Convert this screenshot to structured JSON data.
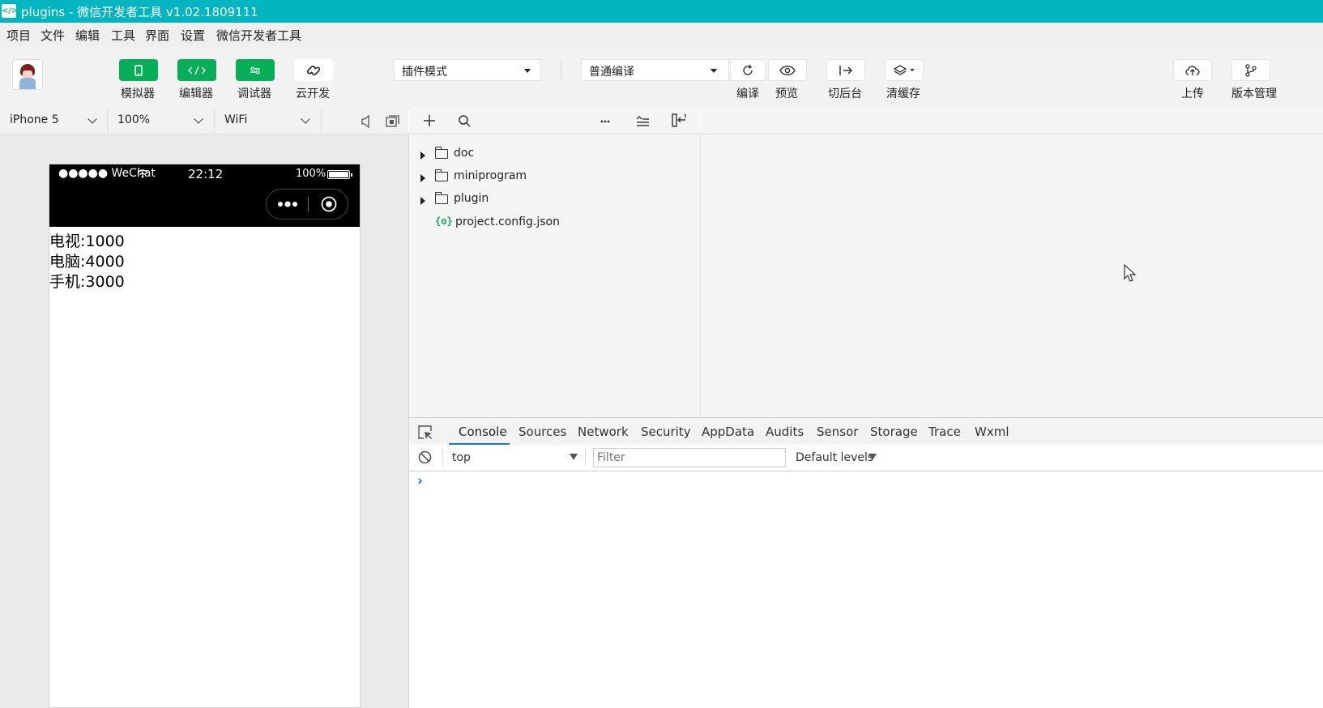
{
  "window": {
    "title": "plugins - 微信开发者工具 v1.02.1809111"
  },
  "menu": [
    "项目",
    "文件",
    "编辑",
    "工具",
    "界面",
    "设置",
    "微信开发者工具"
  ],
  "toolbar": {
    "simulator": "模拟器",
    "editor": "编辑器",
    "debugger": "调试器",
    "cloud": "云开发",
    "mode_select": "插件模式",
    "compile_select": "普通编译",
    "compile": "编译",
    "preview": "预览",
    "background": "切后台",
    "clear_cache": "清缓存",
    "upload": "上传",
    "version": "版本管理"
  },
  "simulator": {
    "device": "iPhone 5",
    "zoom": "100%",
    "network": "WiFi",
    "status": {
      "carrier": "●●●●● WeChat",
      "time": "22:12",
      "battery": "100%"
    },
    "lines": [
      "电视:1000",
      "电脑:4000",
      "手机:3000"
    ]
  },
  "explorer": {
    "items": [
      {
        "name": "doc",
        "type": "folder"
      },
      {
        "name": "miniprogram",
        "type": "folder"
      },
      {
        "name": "plugin",
        "type": "folder"
      },
      {
        "name": "project.config.json",
        "type": "file",
        "icon": "{o}"
      }
    ]
  },
  "devtools": {
    "tabs": [
      "Console",
      "Sources",
      "Network",
      "Security",
      "AppData",
      "Audits",
      "Sensor",
      "Storage",
      "Trace",
      "Wxml"
    ],
    "active_tab": "Console",
    "context": "top",
    "filter_placeholder": "Filter",
    "levels": "Default levels",
    "prompt": "›"
  },
  "colors": {
    "titlebar": "#02b5c0",
    "accent_green": "#07ae58",
    "tab_active": "#1a73e8"
  }
}
